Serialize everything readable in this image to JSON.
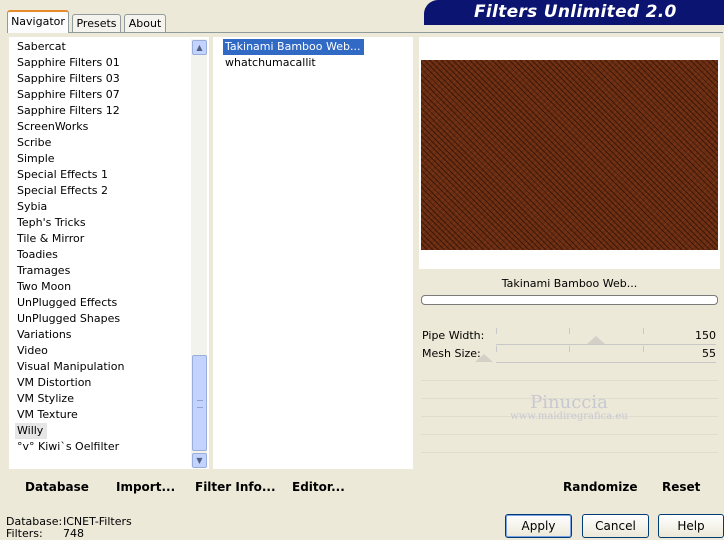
{
  "tabs": [
    {
      "label": "Navigator"
    },
    {
      "label": "Presets"
    },
    {
      "label": "About"
    }
  ],
  "banner": {
    "title": "Filters Unlimited 2.0"
  },
  "categories": [
    "Sabercat",
    "Sapphire Filters 01",
    "Sapphire Filters 03",
    "Sapphire Filters 07",
    "Sapphire Filters 12",
    "ScreenWorks",
    "Scribe",
    "Simple",
    "Special Effects 1",
    "Special Effects 2",
    "Sybia",
    "Teph's Tricks",
    "Tile & Mirror",
    "Toadies",
    "Tramages",
    "Two Moon",
    "UnPlugged Effects",
    "UnPlugged Shapes",
    "Variations",
    "Video",
    "Visual Manipulation",
    "VM Distortion",
    "VM Stylize",
    "VM Texture",
    "Willy",
    "°v° Kiwi`s Oelfilter"
  ],
  "filters": [
    "Takinami Bamboo Web...",
    "whatchumacallit"
  ],
  "preview": {
    "filter_name": "Takinami Bamboo Web...",
    "watermark_name": "Pinuccia",
    "watermark_url": "www.maidiregrafica.eu",
    "colors": {
      "base": "#6b2d12",
      "weave": "#2a0d04"
    }
  },
  "params": [
    {
      "label": "Pipe Width:",
      "value": "150"
    },
    {
      "label": "Mesh Size:",
      "value": "55"
    }
  ],
  "toolbar": {
    "database": "Database",
    "import": "Import...",
    "filter_info": "Filter Info...",
    "editor": "Editor...",
    "randomize": "Randomize",
    "reset": "Reset"
  },
  "status": {
    "database_label": "Database:",
    "database_value": "ICNET-Filters",
    "filters_label": "Filters:",
    "filters_value": "748"
  },
  "buttons": {
    "apply": "Apply",
    "cancel": "Cancel",
    "help": "Help"
  }
}
